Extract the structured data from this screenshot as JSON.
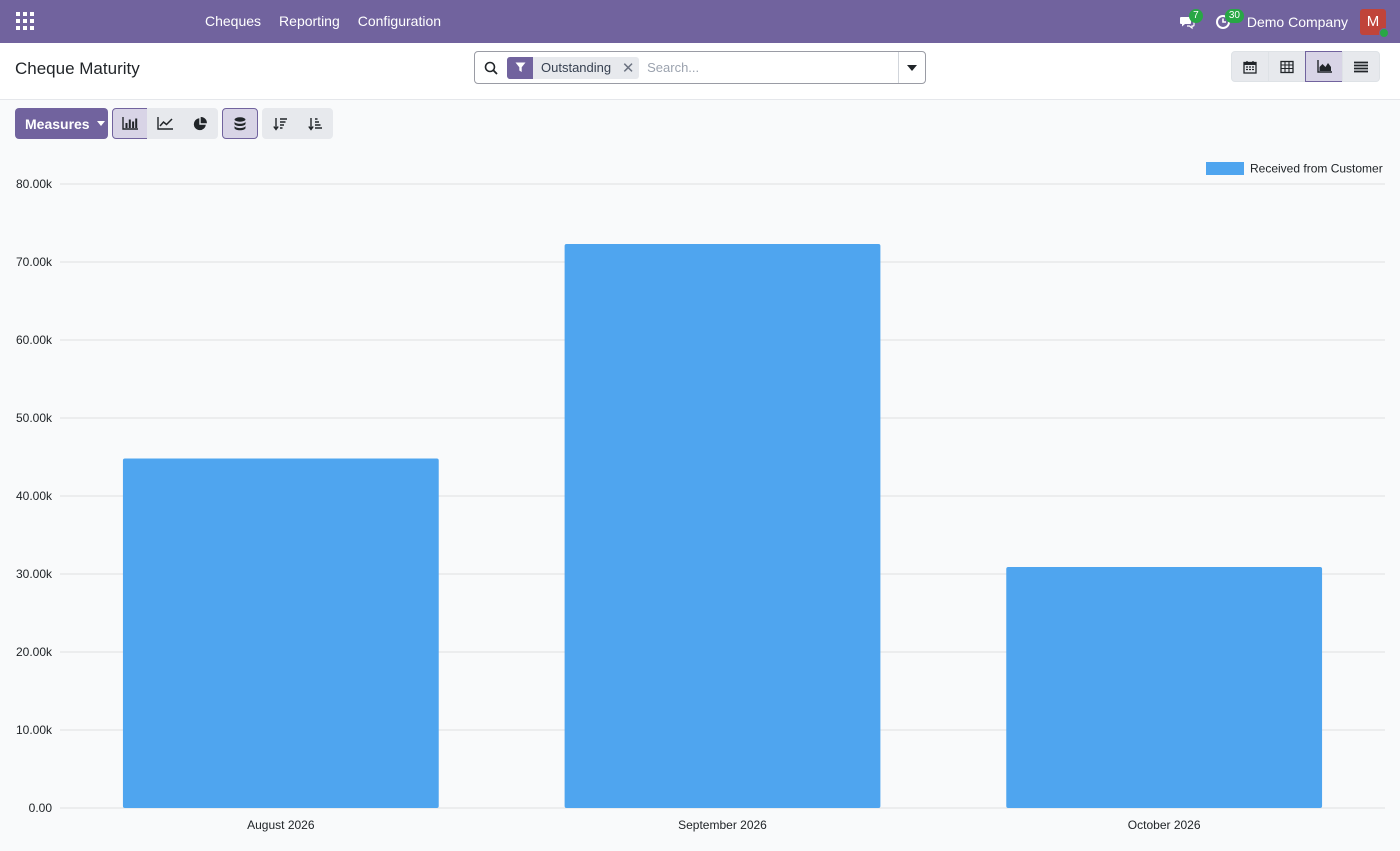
{
  "navbar": {
    "menu": [
      "Cheques",
      "Reporting",
      "Configuration"
    ],
    "messages_badge": "7",
    "activities_badge": "30",
    "company": "Demo Company",
    "avatar_initial": "M"
  },
  "control_panel": {
    "title": "Cheque Maturity",
    "search": {
      "facet": "Outstanding",
      "placeholder": "Search..."
    },
    "views": [
      "calendar-icon",
      "pivot-icon",
      "graph-icon",
      "list-icon"
    ],
    "active_view": "graph"
  },
  "toolbar": {
    "measures_label": "Measures",
    "chart_types": [
      "bar-chart-icon",
      "line-chart-icon",
      "pie-chart-icon"
    ],
    "active_chart_type": "bar",
    "stacked_active": true
  },
  "colors": {
    "brand": "#71639e",
    "bar": "#4fa5ef"
  },
  "chart_data": {
    "type": "bar",
    "categories": [
      "August 2026",
      "September 2026",
      "October 2026"
    ],
    "series": [
      {
        "name": "Received from Customer",
        "values": [
          44800,
          72300,
          30900
        ]
      }
    ],
    "ylim": [
      0,
      80000
    ],
    "yticks": [
      "0.00",
      "10.00k",
      "20.00k",
      "30.00k",
      "40.00k",
      "50.00k",
      "60.00k",
      "70.00k",
      "80.00k"
    ],
    "grid": true,
    "legend_position": "top-right"
  }
}
